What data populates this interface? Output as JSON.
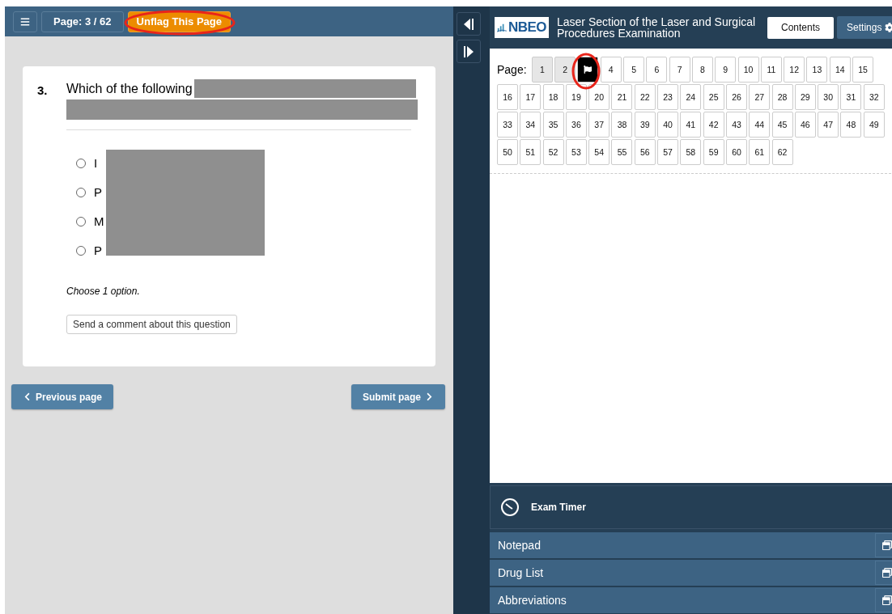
{
  "toolbar": {
    "page_indicator": "Page: 3 / 62",
    "flag_button": "Unflag This Page",
    "flag_annotated": true
  },
  "question": {
    "number": "3.",
    "text_visible": "Which of the following",
    "options": [
      {
        "letter": "I",
        "selected": false
      },
      {
        "letter": "P",
        "selected": false
      },
      {
        "letter": "M",
        "selected": false
      },
      {
        "letter": "P",
        "selected": false
      }
    ],
    "instruction": "Choose 1 option.",
    "comment_button": "Send a comment about this question"
  },
  "navigation": {
    "previous": "Previous page",
    "submit": "Submit page"
  },
  "header": {
    "logo": "NBEO",
    "title": "Laser Section of the Laser and Surgical Procedures Examination",
    "contents_button": "Contents",
    "settings_button": "Settings"
  },
  "page_grid": {
    "label": "Page:",
    "pages": [
      {
        "label": "1",
        "visited": true,
        "flagged": false
      },
      {
        "label": "2",
        "visited": true,
        "flagged": false
      },
      {
        "visited": true,
        "flagged": true,
        "annotated": true
      },
      {
        "label": "4",
        "visited": false,
        "flagged": false
      },
      {
        "label": "5",
        "visited": false,
        "flagged": false
      },
      {
        "label": "6",
        "visited": false,
        "flagged": false
      },
      {
        "label": "7",
        "visited": false,
        "flagged": false
      },
      {
        "label": "8",
        "visited": false,
        "flagged": false
      },
      {
        "label": "9",
        "visited": false,
        "flagged": false
      },
      {
        "label": "10",
        "visited": false,
        "flagged": false
      },
      {
        "label": "11",
        "visited": false,
        "flagged": false
      },
      {
        "label": "12",
        "visited": false,
        "flagged": false
      },
      {
        "label": "13",
        "visited": false,
        "flagged": false
      },
      {
        "label": "14",
        "visited": false,
        "flagged": false
      },
      {
        "label": "15",
        "visited": false,
        "flagged": false
      },
      {
        "label": "16",
        "visited": false,
        "flagged": false
      },
      {
        "label": "17",
        "visited": false,
        "flagged": false
      },
      {
        "label": "18",
        "visited": false,
        "flagged": false
      },
      {
        "label": "19",
        "visited": false,
        "flagged": false
      },
      {
        "label": "20",
        "visited": false,
        "flagged": false
      },
      {
        "label": "21",
        "visited": false,
        "flagged": false
      },
      {
        "label": "22",
        "visited": false,
        "flagged": false
      },
      {
        "label": "23",
        "visited": false,
        "flagged": false
      },
      {
        "label": "24",
        "visited": false,
        "flagged": false
      },
      {
        "label": "25",
        "visited": false,
        "flagged": false
      },
      {
        "label": "26",
        "visited": false,
        "flagged": false
      },
      {
        "label": "27",
        "visited": false,
        "flagged": false
      },
      {
        "label": "28",
        "visited": false,
        "flagged": false
      },
      {
        "label": "29",
        "visited": false,
        "flagged": false
      },
      {
        "label": "30",
        "visited": false,
        "flagged": false
      },
      {
        "label": "31",
        "visited": false,
        "flagged": false
      },
      {
        "label": "32",
        "visited": false,
        "flagged": false
      },
      {
        "label": "33",
        "visited": false,
        "flagged": false
      },
      {
        "label": "34",
        "visited": false,
        "flagged": false
      },
      {
        "label": "35",
        "visited": false,
        "flagged": false
      },
      {
        "label": "36",
        "visited": false,
        "flagged": false
      },
      {
        "label": "37",
        "visited": false,
        "flagged": false
      },
      {
        "label": "38",
        "visited": false,
        "flagged": false
      },
      {
        "label": "39",
        "visited": false,
        "flagged": false
      },
      {
        "label": "40",
        "visited": false,
        "flagged": false
      },
      {
        "label": "41",
        "visited": false,
        "flagged": false
      },
      {
        "label": "42",
        "visited": false,
        "flagged": false
      },
      {
        "label": "43",
        "visited": false,
        "flagged": false
      },
      {
        "label": "44",
        "visited": false,
        "flagged": false
      },
      {
        "label": "45",
        "visited": false,
        "flagged": false
      },
      {
        "label": "46",
        "visited": false,
        "flagged": false
      },
      {
        "label": "47",
        "visited": false,
        "flagged": false
      },
      {
        "label": "48",
        "visited": false,
        "flagged": false
      },
      {
        "label": "49",
        "visited": false,
        "flagged": false
      },
      {
        "label": "50",
        "visited": false,
        "flagged": false
      },
      {
        "label": "51",
        "visited": false,
        "flagged": false
      },
      {
        "label": "52",
        "visited": false,
        "flagged": false
      },
      {
        "label": "53",
        "visited": false,
        "flagged": false
      },
      {
        "label": "54",
        "visited": false,
        "flagged": false
      },
      {
        "label": "55",
        "visited": false,
        "flagged": false
      },
      {
        "label": "56",
        "visited": false,
        "flagged": false
      },
      {
        "label": "57",
        "visited": false,
        "flagged": false
      },
      {
        "label": "58",
        "visited": false,
        "flagged": false
      },
      {
        "label": "59",
        "visited": false,
        "flagged": false
      },
      {
        "label": "60",
        "visited": false,
        "flagged": false
      },
      {
        "label": "61",
        "visited": false,
        "flagged": false
      },
      {
        "label": "62",
        "visited": false,
        "flagged": false
      }
    ]
  },
  "timer": {
    "label": "Exam Timer"
  },
  "tools": [
    {
      "label": "Notepad"
    },
    {
      "label": "Drug List"
    },
    {
      "label": "Abbreviations"
    }
  ]
}
